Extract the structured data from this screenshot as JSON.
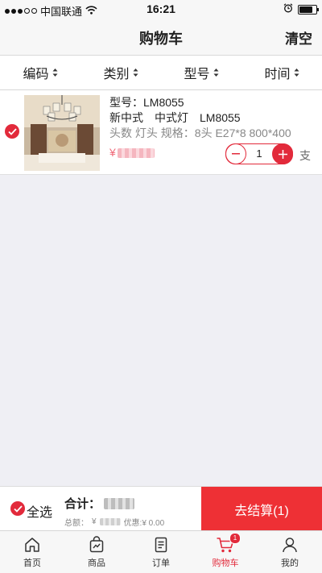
{
  "status_bar": {
    "carrier": "中国联通",
    "time": "16:21"
  },
  "header": {
    "title": "购物车",
    "clear_label": "清空"
  },
  "sort_bar": {
    "items": [
      {
        "label": "编码"
      },
      {
        "label": "类别"
      },
      {
        "label": "型号"
      },
      {
        "label": "时间"
      }
    ]
  },
  "cart": {
    "items": [
      {
        "model_line": "型号：LM8055",
        "category_line": "新中式　中式灯　LM8055",
        "spec_line": "头数 灯头 规格：8头 E27*8 800*400",
        "price_symbol": "¥",
        "quantity": "1",
        "unit": "支",
        "selected": true
      }
    ]
  },
  "checkout": {
    "select_all_label": "全选",
    "total_label": "合计：",
    "total_amount_label": "总额：",
    "currency_symbol": "¥",
    "discount_label": "优惠:¥ 0.00",
    "settle_label": "去结算(1)"
  },
  "tab_bar": {
    "tabs": [
      {
        "label": "首页",
        "icon": "home-icon"
      },
      {
        "label": "商品",
        "icon": "bag-icon"
      },
      {
        "label": "订单",
        "icon": "document-icon"
      },
      {
        "label": "购物车",
        "icon": "cart-icon",
        "badge": "1",
        "active": true
      },
      {
        "label": "我的",
        "icon": "person-icon"
      }
    ]
  },
  "colors": {
    "accent": "#e22a3b",
    "settle_bg": "#ee3035",
    "price": "#f06c7b",
    "background": "#efeff4"
  }
}
